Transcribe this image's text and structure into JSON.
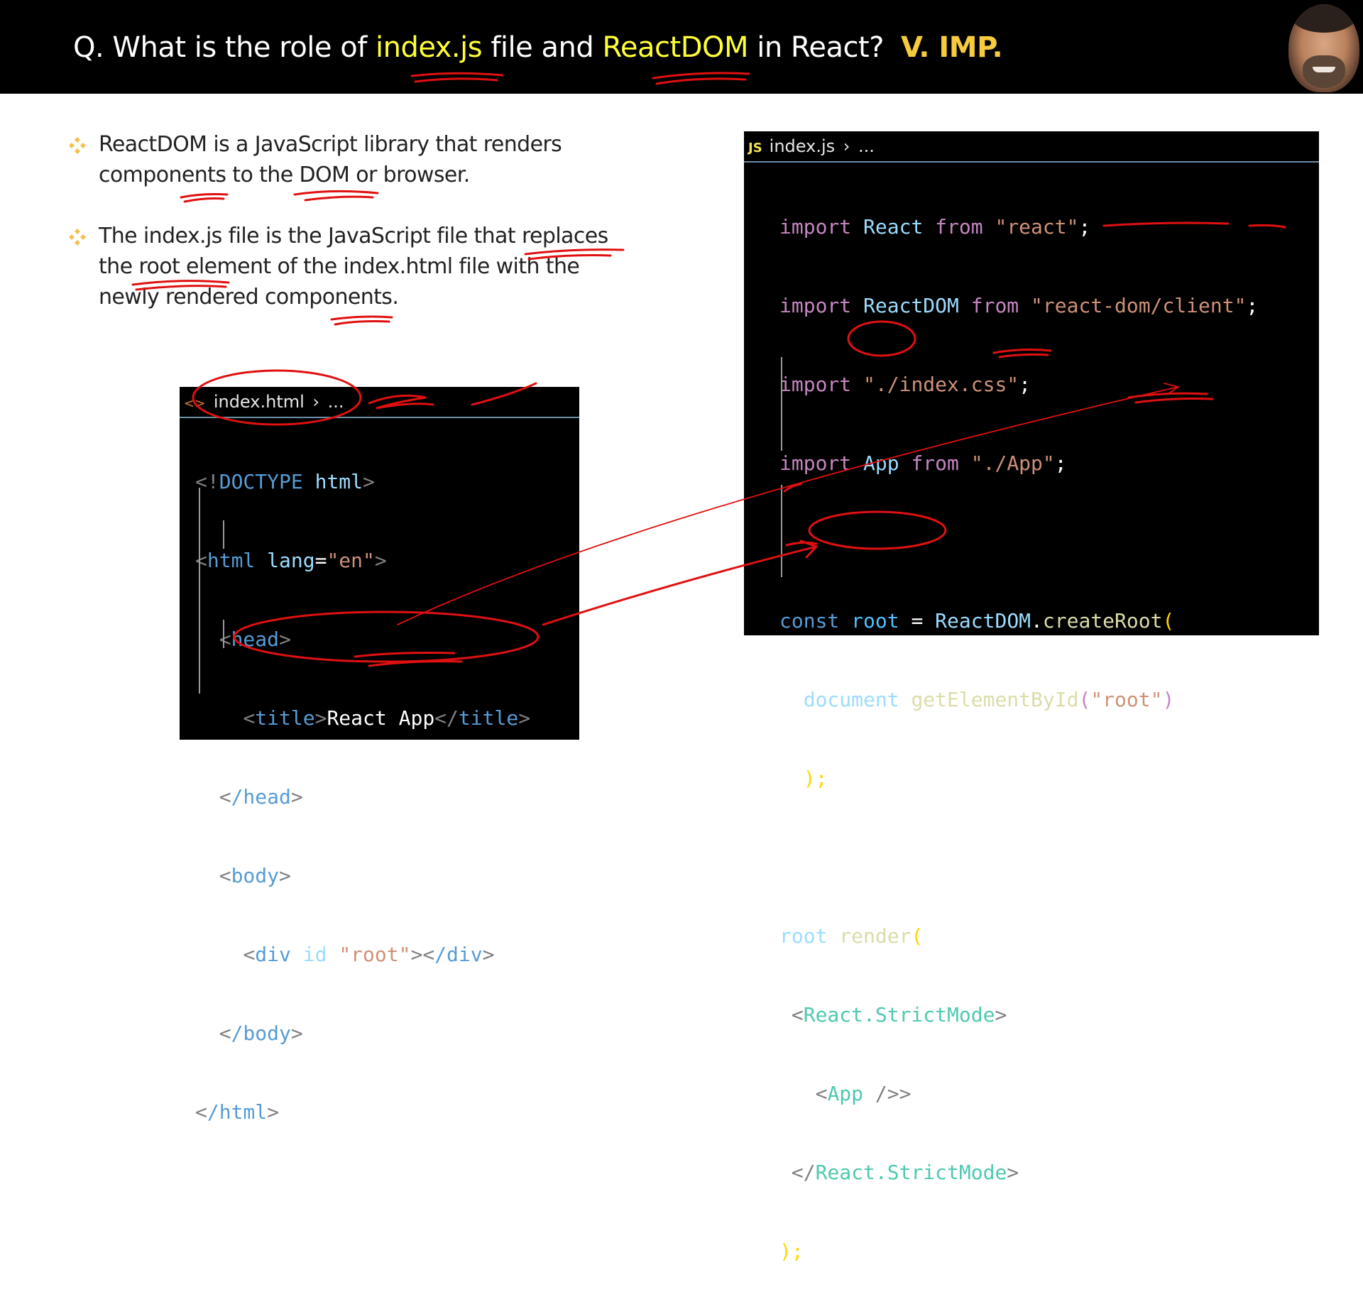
{
  "header": {
    "question_prefix": "Q. What is the role of ",
    "highlight_1": "index.js",
    "mid_text": " file and ",
    "highlight_2": "ReactDOM",
    "suffix": " in React?",
    "importance": "V. IMP."
  },
  "bullets": [
    {
      "text": "ReactDOM is a JavaScript library that renders components to the DOM or browser."
    },
    {
      "text": "The index.js file is the JavaScript file that replaces the root element of the index.html file with the newly rendered components."
    }
  ],
  "html_file": {
    "tab_icon": "<>",
    "tab_label": "index.html",
    "breadcrumb": "...",
    "lines": {
      "l1_open": "<!",
      "l1_doctype": "DOCTYPE",
      "l1_html": "html",
      "l1_close": ">",
      "l2_open": "<",
      "l2_tag": "html",
      "l2_attr": "lang",
      "l2_eq": "=",
      "l2_val": "\"en\"",
      "l2_close": ">",
      "l3": "head",
      "l4_tag": "title",
      "l4_text": "React App",
      "l5": "/head",
      "l6": "body",
      "l7_tag": "div",
      "l7_attr": "id",
      "l7_val": "\"root\"",
      "l7_end": "/div",
      "l8": "/body",
      "l9": "/html"
    }
  },
  "js_file": {
    "tab_icon": "JS",
    "tab_label": "index.js",
    "breadcrumb": "...",
    "lines": {
      "kw_import": "import",
      "kw_from": "from",
      "l1_name": "React",
      "l1_src": "\"react\"",
      "l2_name": "ReactDOM",
      "l2_src": "\"react-dom/client\"",
      "l3_src": "\"./index.css\"",
      "l4_name": "App",
      "l4_src": "\"./App\"",
      "semi": ";",
      "kw_const": "const",
      "root": "root",
      "eq": " = ",
      "reactdom": "ReactDOM",
      "dot": ".",
      "create_root": "createRoot",
      "paren_open": "(",
      "document": "document",
      "get_by_id": "getElementById",
      "root_str": "\"root\"",
      "paren_close": ")",
      "close_stmt": ");",
      "render": "render",
      "strict_mode": "React.StrictMode",
      "app_tag": "App",
      "self_close": " />"
    }
  }
}
